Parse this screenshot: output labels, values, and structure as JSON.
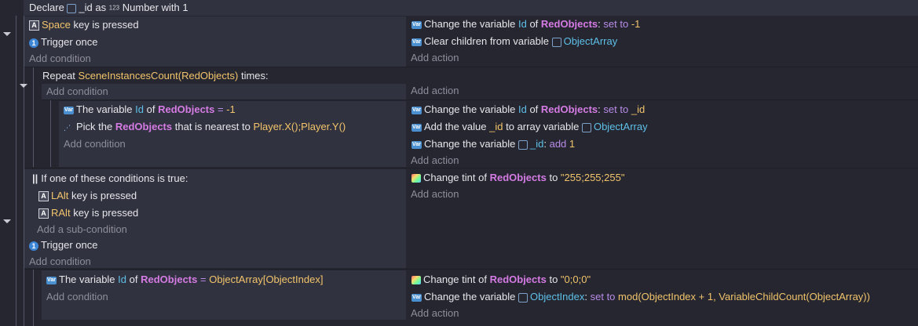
{
  "declare": {
    "prefix": "Declare",
    "name": "_id",
    "as": "as",
    "type_badge": "123",
    "type_label": "Number with",
    "value": "1"
  },
  "common": {
    "add_condition": "Add condition",
    "add_action": "Add action",
    "add_subcondition": "Add a sub-condition"
  },
  "event1": {
    "cond1": {
      "key": "Space",
      "text": "key is pressed"
    },
    "cond2": {
      "text": "Trigger once"
    },
    "act1": {
      "a": "Change the variable",
      "var": "Id",
      "of": "of",
      "obj": "RedObjects",
      "colon": ":",
      "op": "set to",
      "val": "-1"
    },
    "act2": {
      "a": "Clear children from variable",
      "var": "ObjectArray"
    }
  },
  "repeat": {
    "a": "Repeat",
    "expr": "SceneInstancesCount(RedObjects)",
    "b": "times:"
  },
  "event2": {
    "cond1": {
      "a": "The variable",
      "var": "Id",
      "of": "of",
      "obj": "RedObjects",
      "eq": "=",
      "val": "-1"
    },
    "cond2": {
      "a": "Pick the",
      "obj": "RedObjects",
      "b": "that is nearest to",
      "val": "Player.X();Player.Y()"
    },
    "act1": {
      "a": "Change the variable",
      "var": "Id",
      "of": "of",
      "obj": "RedObjects",
      "colon": ":",
      "op": "set to",
      "val": "_id"
    },
    "act2": {
      "a": "Add the value",
      "val": "_id",
      "b": "to array variable",
      "var": "ObjectArray"
    },
    "act3": {
      "a": "Change the variable",
      "var": "_id",
      "colon": ":",
      "op": "add",
      "val": "1"
    }
  },
  "event3": {
    "or_label": "If one of these conditions is true:",
    "sub1": {
      "key": "LAlt",
      "text": "key is pressed"
    },
    "sub2": {
      "key": "RAlt",
      "text": "key is pressed"
    },
    "cond2": {
      "text": "Trigger once"
    },
    "act1": {
      "a": "Change tint of",
      "obj": "RedObjects",
      "to": "to",
      "val": "\"255;255;255\""
    }
  },
  "event4": {
    "cond1": {
      "a": "The variable",
      "var": "Id",
      "of": "of",
      "obj": "RedObjects",
      "eq": "=",
      "val": "ObjectArray[ObjectIndex]"
    },
    "act1": {
      "a": "Change tint of",
      "obj": "RedObjects",
      "to": "to",
      "val": "\"0;0;0\""
    },
    "act2": {
      "a": "Change the variable",
      "var": "ObjectIndex",
      "colon": ":",
      "op": "set to",
      "val": "mod(ObjectIndex + 1, VariableChildCount(ObjectArray))"
    }
  },
  "colors": {
    "background": "#252630",
    "panel": "#31323f",
    "object": "#d57be4",
    "variable": "#5ec0e8",
    "value": "#f2c46b"
  },
  "icons": [
    "keyboard-key-icon",
    "trigger-once-icon",
    "variable-icon",
    "tint-icon",
    "pick-nearest-icon",
    "array-icon",
    "collapse-chevron-icon"
  ]
}
